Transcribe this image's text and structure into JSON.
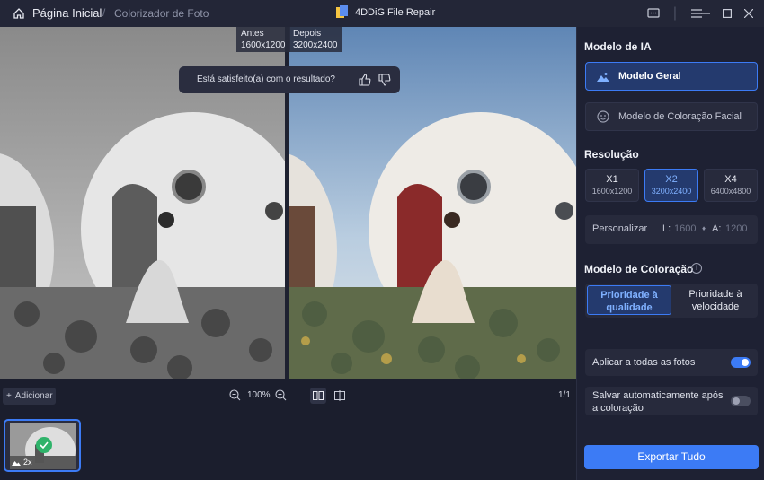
{
  "titlebar": {
    "home_label": "Página Inicial",
    "separator": "/",
    "current": "Colorizador de Foto",
    "app_title": "4DDiG File Repair"
  },
  "canvas": {
    "before_tag": {
      "title": "Antes",
      "size": "1600x1200"
    },
    "after_tag": {
      "title": "Depois",
      "size": "3200x2400"
    },
    "feedback_text": "Está satisfeito(a) com o resultado?"
  },
  "toolbar": {
    "add_label": "Adicionar",
    "zoom_level": "100%",
    "page_count": "1/1"
  },
  "filmstrip": {
    "items": [
      {
        "scale": "2x",
        "status": "done"
      }
    ]
  },
  "panel": {
    "ai_model_title": "Modelo de IA",
    "models": [
      {
        "label": "Modelo Geral",
        "icon": "landscape-icon",
        "active": true
      },
      {
        "label": "Modelo de Coloração Facial",
        "icon": "face-icon",
        "active": false
      }
    ],
    "resolution_title": "Resolução",
    "resolutions": [
      {
        "label": "X1",
        "size": "1600x1200",
        "active": false
      },
      {
        "label": "X2",
        "size": "3200x2400",
        "active": true
      },
      {
        "label": "X4",
        "size": "6400x4800",
        "active": false
      }
    ],
    "custom": {
      "label": "Personalizar",
      "l_label": "L:",
      "l_value": "1600",
      "a_label": "A:",
      "a_value": "1200"
    },
    "coloring_title": "Modelo de Coloração",
    "coloring_options": [
      {
        "label": "Prioridade à qualidade",
        "active": true
      },
      {
        "label": "Prioridade à velocidade",
        "active": false
      }
    ],
    "apply_all": {
      "label": "Aplicar a todas as fotos",
      "on": true
    },
    "auto_save": {
      "label": "Salvar automaticamente após a coloração",
      "on": false
    },
    "export_label": "Exportar Tudo"
  },
  "colors": {
    "accent": "#3c7bf5",
    "background": "#1b1e2d",
    "panel": "#1e2133",
    "success": "#2fb36a"
  }
}
